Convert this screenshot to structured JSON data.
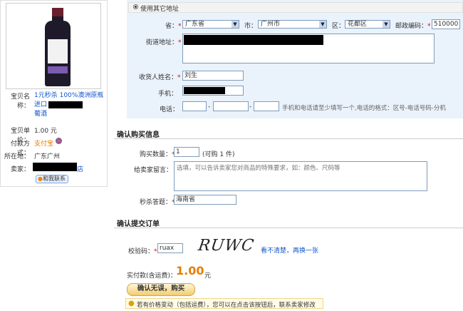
{
  "item": {
    "name_label": "宝贝名称：",
    "name_value": "1元秒杀 100%澳洲原瓶进口",
    "name_value2": "葡酒",
    "price_label": "宝贝单价：",
    "price_value": "1.00 元",
    "pay_label": "付款方式：",
    "pay_value": "支付宝",
    "location_label": "所在地：",
    "location_value": "广东广州",
    "seller_label": "卖家：",
    "seller_suffix": "店",
    "contact_label": "和我联系"
  },
  "address": {
    "use_other": "使用其它地址",
    "province_label": "省：",
    "province_value": "广东省",
    "city_label": "市：",
    "city_value": "广州市",
    "district_label": "区：",
    "district_value": "花都区",
    "zip_label": "邮政编码：",
    "zip_value": "510000",
    "street_label": "街道地址：",
    "receiver_label": "收货人姓名：",
    "receiver_value": "刘生",
    "mobile_label": "手机：",
    "phone_label": "电话：",
    "phone_hint": "手机和电话请至少填写一个,电话的格式：区号-电话号码-分机",
    "phone_sep": "-"
  },
  "confirm": {
    "title": "确认购买信息",
    "qty_label": "购买数量：",
    "qty_value": "1",
    "qty_hint": "(可购 1 件)",
    "msg_label": "给卖家留言：",
    "msg_placeholder": "选填，可以告诉卖家您对商品的特殊要求，如：颜色、尺码等",
    "answer_label": "秒杀答题：",
    "answer_value": "海南省"
  },
  "submit": {
    "title": "确认提交订单",
    "captcha_label": "校验码：",
    "captcha_value": "ruax",
    "captcha_text": "RUWC",
    "refresh_link": "看不清楚，再换一张",
    "total_label": "实付款(含运费)：",
    "total_value": "1.00",
    "total_unit": "元",
    "button_label": "确认无误，购买",
    "tip": "若有价格变动（包括运费），您可以在点击该按钮后，联系卖家修改"
  }
}
